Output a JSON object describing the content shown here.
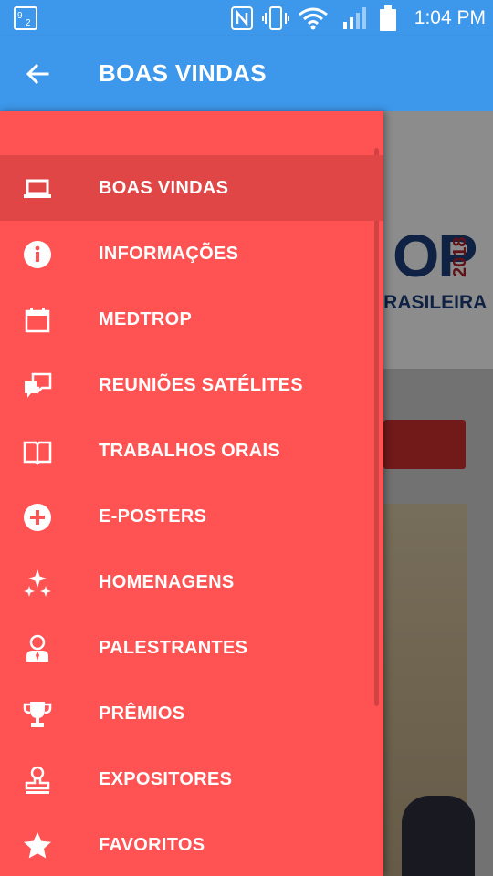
{
  "status_bar": {
    "time": "1:04 PM",
    "icons": [
      "sim-icon",
      "nfc-icon",
      "vibrate-icon",
      "wifi-icon",
      "signal-icon",
      "battery-icon"
    ]
  },
  "app_bar": {
    "title": "BOAS VINDAS",
    "back_icon": "arrow-left-icon"
  },
  "background": {
    "logo_text": "OP",
    "logo_year": "2018",
    "subtitle": "BRASILEIRA"
  },
  "drawer": {
    "selected_index": 0,
    "items": [
      {
        "label": "BOAS VINDAS",
        "icon": "laptop-icon"
      },
      {
        "label": "INFORMAÇÕES",
        "icon": "info-icon"
      },
      {
        "label": "MEDTROP",
        "icon": "calendar-icon"
      },
      {
        "label": "REUNIÕES SATÉLITES",
        "icon": "chat-bubbles-icon"
      },
      {
        "label": "TRABALHOS ORAIS",
        "icon": "book-icon"
      },
      {
        "label": "E-POSTERS",
        "icon": "add-circle-icon"
      },
      {
        "label": "HOMENAGENS",
        "icon": "sparkles-icon"
      },
      {
        "label": "PALESTRANTES",
        "icon": "person-tie-icon"
      },
      {
        "label": "PRÊMIOS",
        "icon": "trophy-icon"
      },
      {
        "label": "EXPOSITORES",
        "icon": "stamp-icon"
      },
      {
        "label": "FAVORITOS",
        "icon": "star-icon"
      }
    ]
  }
}
